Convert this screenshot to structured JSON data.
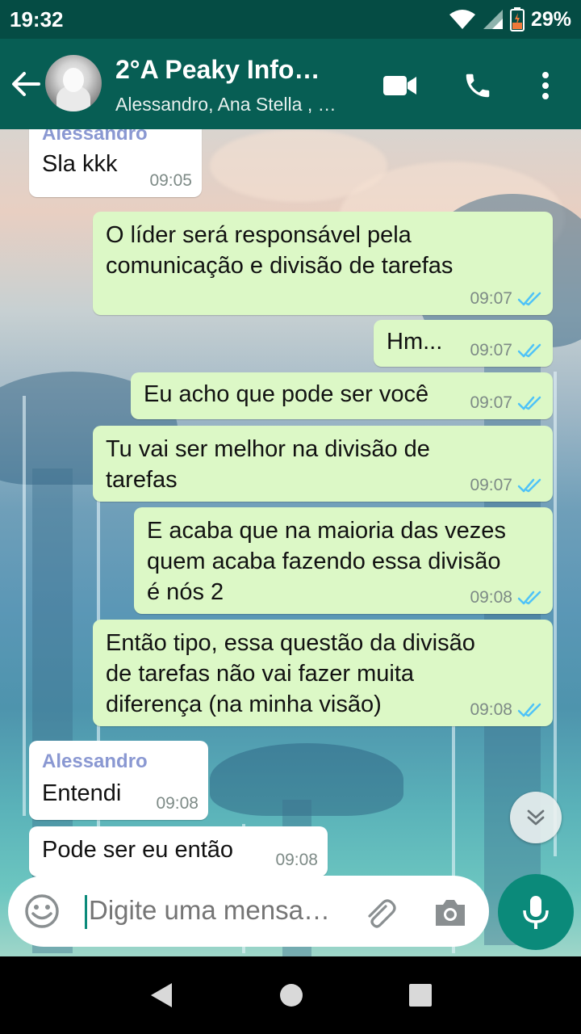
{
  "status_bar": {
    "time": "19:32",
    "battery": "29%"
  },
  "header": {
    "title": "2°A Peaky Info…",
    "subtitle": "Alessandro, Ana Stella , …"
  },
  "messages": [
    {
      "direction": "in",
      "sender": "Alessandro",
      "text": "Sla kkk",
      "time": "09:05"
    },
    {
      "direction": "out",
      "text": "O líder será responsável pela\ncomunicação e divisão de tarefas",
      "time": "09:07",
      "status": "read"
    },
    {
      "direction": "out",
      "text": "Hm...",
      "time": "09:07",
      "status": "read"
    },
    {
      "direction": "out",
      "text": "Eu acho que pode ser você",
      "time": "09:07",
      "status": "read"
    },
    {
      "direction": "out",
      "text": "Tu vai ser melhor na divisão de\ntarefas",
      "time": "09:07",
      "status": "read"
    },
    {
      "direction": "out",
      "text": "E acaba que na maioria das vezes\nquem acaba fazendo essa divisão\né nós 2",
      "time": "09:08",
      "status": "read"
    },
    {
      "direction": "out",
      "text": "Então tipo, essa questão da divisão\nde tarefas não vai fazer muita\ndiferença (na minha visão)",
      "time": "09:08",
      "status": "read"
    },
    {
      "direction": "in",
      "sender": "Alessandro",
      "text": "Entendi",
      "time": "09:08"
    },
    {
      "direction": "in",
      "text": "Pode ser eu então",
      "time": "09:08"
    }
  ],
  "composer": {
    "placeholder": "Digite uma mensa…"
  },
  "colors": {
    "header": "#075e54",
    "status_bar": "#054c44",
    "outgoing_bubble": "#dcf8c6",
    "incoming_bubble": "#ffffff",
    "accent": "#0b8a7a",
    "read_ticks": "#4fc3f7",
    "sender_name": "#8a98d2"
  },
  "icons": [
    "arrow-back-icon",
    "video-call-icon",
    "phone-icon",
    "more-vert-icon",
    "emoji-icon",
    "attach-icon",
    "camera-icon",
    "mic-icon",
    "double-check-icon",
    "chevrons-down-icon",
    "nav-back-icon",
    "nav-home-icon",
    "nav-recents-icon",
    "wifi-icon",
    "signal-icon",
    "battery-icon"
  ]
}
